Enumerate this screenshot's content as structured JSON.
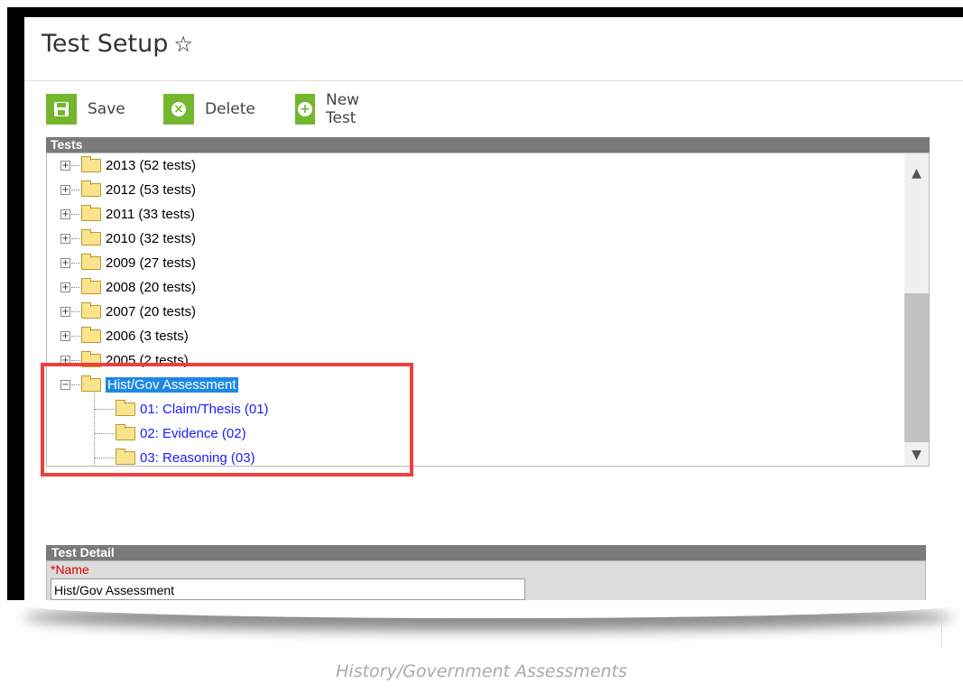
{
  "header": {
    "title": "Test Setup",
    "star_glyph": "☆"
  },
  "toolbar": {
    "save_label": "Save",
    "delete_label": "Delete",
    "new_label": "New Test",
    "save_icon": "floppy-icon",
    "delete_icon": "x-circle-icon",
    "new_icon": "plus-circle-icon",
    "accent_color": "#74b72e"
  },
  "tests_panel": {
    "title": "Tests",
    "years": [
      "2013 (52 tests)",
      "2012 (53 tests)",
      "2011 (33 tests)",
      "2010 (32 tests)",
      "2009 (27 tests)",
      "2008 (20 tests)",
      "2007 (20 tests)",
      "2006 (3 tests)",
      "2005 (2 tests)"
    ],
    "selected_node": "Hist/Gov Assessment",
    "children": [
      "01: Claim/Thesis (01)",
      "02: Evidence (02)",
      "03: Reasoning (03)"
    ],
    "selection_color": "#1e88e5",
    "highlight_color": "#ef3f3f"
  },
  "detail": {
    "title": "Test Detail",
    "name_label": "*Name",
    "name_value": "Hist/Gov Assessment"
  },
  "caption": "History/Government Assessments"
}
